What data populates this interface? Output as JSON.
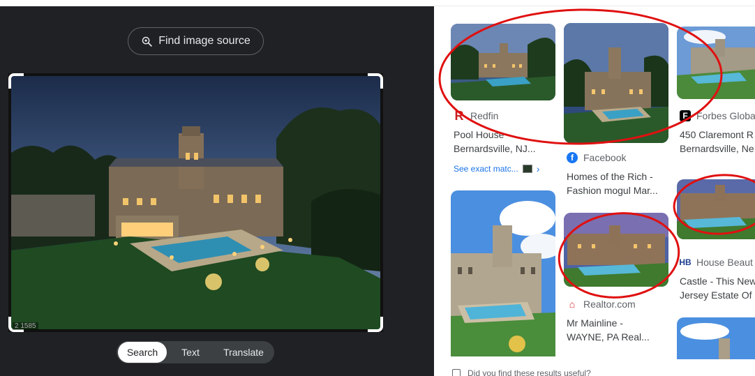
{
  "left": {
    "find_source_label": "Find image source",
    "watermark": "2 1585",
    "modes": [
      "Search",
      "Text",
      "Translate"
    ],
    "active_mode": "Search"
  },
  "results": [
    {
      "source": "Redfin",
      "title_lines": [
        "Pool House -",
        "Bernardsville, NJ..."
      ],
      "exact_match": "See exact matc...",
      "favicon": "redfin-icon",
      "favicon_color": "#c82021"
    },
    {
      "source": "Facebook",
      "title_lines": [
        "Homes of the Rich -",
        "Fashion mogul Mar..."
      ],
      "favicon": "facebook-icon",
      "favicon_color": "#1877f2"
    },
    {
      "source": "Forbes Global",
      "title_lines": [
        "450 Claremont R",
        "Bernardsville, Ne"
      ],
      "favicon": "forbes-icon",
      "favicon_color": "#000000"
    },
    {
      "source": "Realtor.com",
      "title_lines": [
        "Mr Mainline -",
        "WAYNE, PA Real..."
      ],
      "favicon": "realtor-icon",
      "favicon_color": "#d92228"
    },
    {
      "source": "House Beaut",
      "title_lines": [
        "Castle - This New",
        "Jersey Estate Of"
      ],
      "favicon": "house-beautiful-icon",
      "favicon_color": "#1a3d8f"
    }
  ],
  "feedback": "Did you find these results useful?",
  "annotation_color": "#e01010"
}
